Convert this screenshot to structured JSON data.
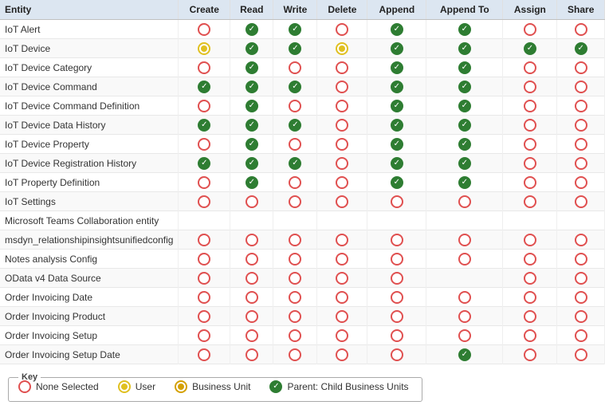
{
  "header": {
    "columns": [
      "Entity",
      "Create",
      "Read",
      "Write",
      "Delete",
      "Append",
      "Append To",
      "Assign",
      "Share"
    ]
  },
  "rows": [
    {
      "entity": "IoT Alert",
      "create": "none",
      "read": "parent-child",
      "write": "parent-child",
      "delete": "none",
      "append": "parent-child",
      "appendTo": "parent-child",
      "assign": "none",
      "share": "none"
    },
    {
      "entity": "IoT Device",
      "create": "user",
      "read": "parent-child",
      "write": "parent-child",
      "delete": "user",
      "append": "parent-child",
      "appendTo": "parent-child",
      "assign": "parent-child",
      "share": "parent-child"
    },
    {
      "entity": "IoT Device Category",
      "create": "none",
      "read": "parent-child",
      "write": "none",
      "delete": "none",
      "append": "parent-child",
      "appendTo": "parent-child",
      "assign": "none",
      "share": "none"
    },
    {
      "entity": "IoT Device Command",
      "create": "parent-child",
      "read": "parent-child",
      "write": "parent-child",
      "delete": "none",
      "append": "parent-child",
      "appendTo": "parent-child",
      "assign": "none",
      "share": "none"
    },
    {
      "entity": "IoT Device Command Definition",
      "create": "none",
      "read": "parent-child",
      "write": "none",
      "delete": "none",
      "append": "parent-child",
      "appendTo": "parent-child",
      "assign": "none",
      "share": "none"
    },
    {
      "entity": "IoT Device Data History",
      "create": "parent-child",
      "read": "parent-child",
      "write": "parent-child",
      "delete": "none",
      "append": "parent-child",
      "appendTo": "parent-child",
      "assign": "none",
      "share": "none"
    },
    {
      "entity": "IoT Device Property",
      "create": "none",
      "read": "parent-child",
      "write": "none",
      "delete": "none",
      "append": "parent-child",
      "appendTo": "parent-child",
      "assign": "none",
      "share": "none"
    },
    {
      "entity": "IoT Device Registration History",
      "create": "parent-child",
      "read": "parent-child",
      "write": "parent-child",
      "delete": "none",
      "append": "parent-child",
      "appendTo": "parent-child",
      "assign": "none",
      "share": "none"
    },
    {
      "entity": "IoT Property Definition",
      "create": "none",
      "read": "parent-child",
      "write": "none",
      "delete": "none",
      "append": "parent-child",
      "appendTo": "parent-child",
      "assign": "none",
      "share": "none"
    },
    {
      "entity": "IoT Settings",
      "create": "none",
      "read": "none",
      "write": "none",
      "delete": "none",
      "append": "none",
      "appendTo": "none",
      "assign": "none",
      "share": "none"
    },
    {
      "entity": "Microsoft Teams Collaboration entity",
      "create": "",
      "read": "",
      "write": "",
      "delete": "",
      "append": "",
      "appendTo": "",
      "assign": "",
      "share": ""
    },
    {
      "entity": "msdyn_relationshipinsightsunifiedconfig",
      "create": "none",
      "read": "none",
      "write": "none",
      "delete": "none",
      "append": "none",
      "appendTo": "none",
      "assign": "none",
      "share": "none"
    },
    {
      "entity": "Notes analysis Config",
      "create": "none",
      "read": "none",
      "write": "none",
      "delete": "none",
      "append": "none",
      "appendTo": "none",
      "assign": "none",
      "share": "none"
    },
    {
      "entity": "OData v4 Data Source",
      "create": "none",
      "read": "none",
      "write": "none",
      "delete": "none",
      "append": "none",
      "appendTo": "",
      "assign": "none",
      "share": "none"
    },
    {
      "entity": "Order Invoicing Date",
      "create": "none",
      "read": "none",
      "write": "none",
      "delete": "none",
      "append": "none",
      "appendTo": "none",
      "assign": "none",
      "share": "none"
    },
    {
      "entity": "Order Invoicing Product",
      "create": "none",
      "read": "none",
      "write": "none",
      "delete": "none",
      "append": "none",
      "appendTo": "none",
      "assign": "none",
      "share": "none"
    },
    {
      "entity": "Order Invoicing Setup",
      "create": "none",
      "read": "none",
      "write": "none",
      "delete": "none",
      "append": "none",
      "appendTo": "none",
      "assign": "none",
      "share": "none"
    },
    {
      "entity": "Order Invoicing Setup Date",
      "create": "none",
      "read": "none",
      "write": "none",
      "delete": "none",
      "append": "none",
      "appendTo": "parent-child",
      "assign": "none",
      "share": "none"
    }
  ],
  "key": {
    "title": "Key",
    "items": [
      {
        "label": "None Selected",
        "type": "none"
      },
      {
        "label": "User",
        "type": "user"
      },
      {
        "label": "Business Unit",
        "type": "business-unit"
      },
      {
        "label": "Parent: Child Business Units",
        "type": "parent-child"
      }
    ]
  }
}
